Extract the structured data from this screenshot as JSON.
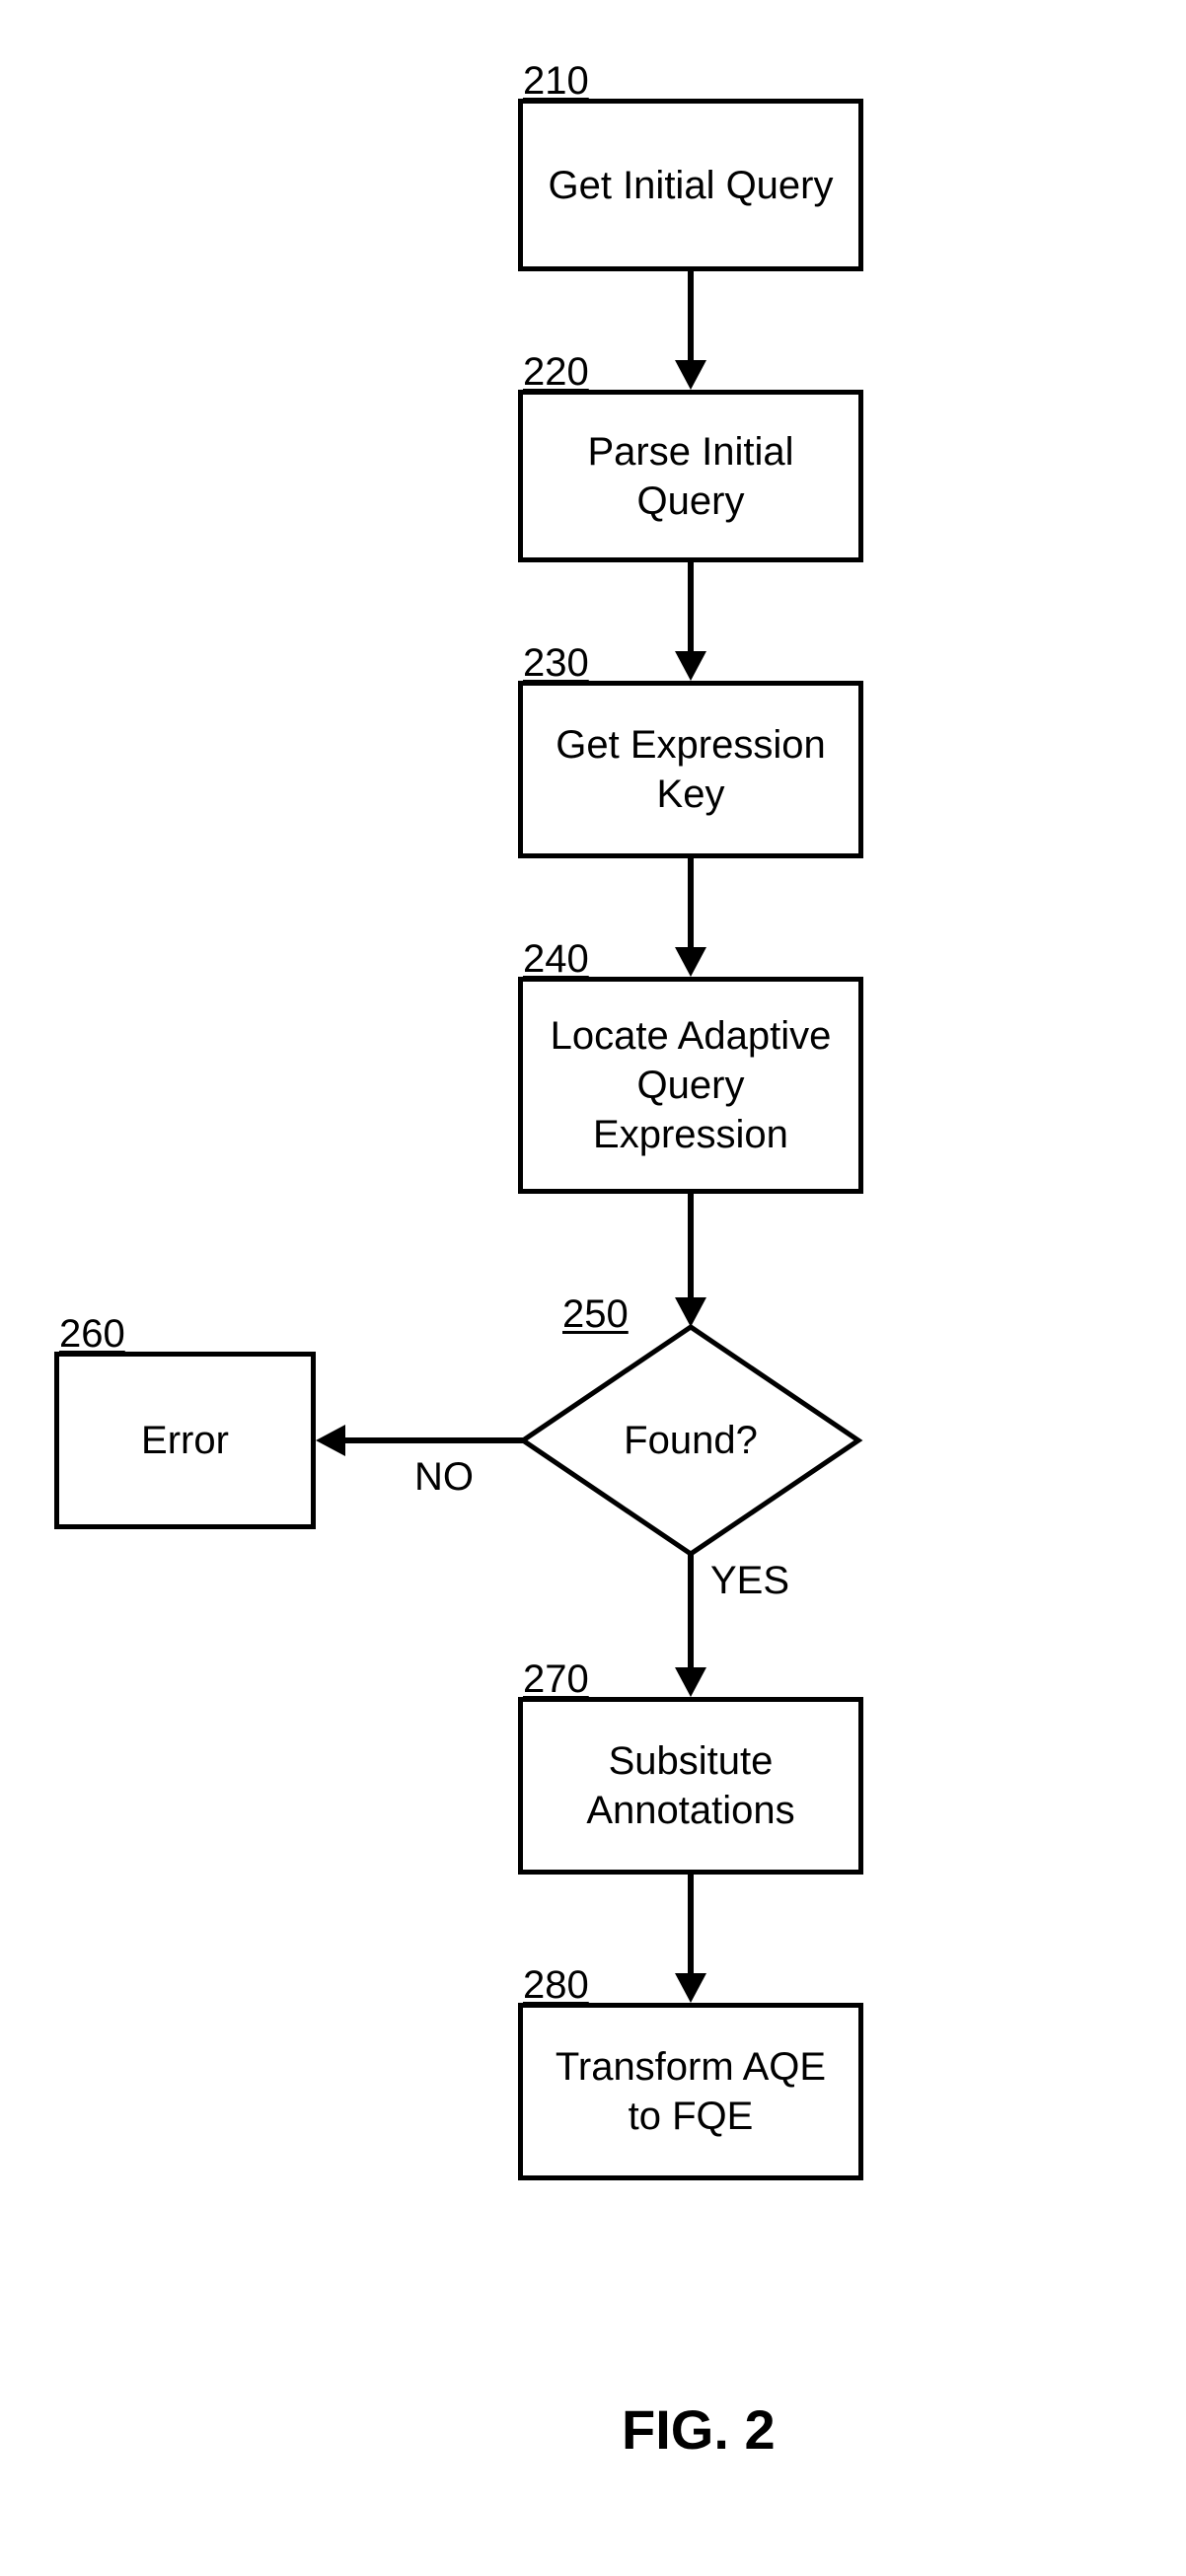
{
  "nodes": {
    "n210": {
      "num": "210",
      "label": "Get Initial Query"
    },
    "n220": {
      "num": "220",
      "label": "Parse Initial\nQuery"
    },
    "n230": {
      "num": "230",
      "label": "Get Expression\nKey"
    },
    "n240": {
      "num": "240",
      "label": "Locate Adaptive\nQuery\nExpression"
    },
    "n250": {
      "num": "250",
      "label": "Found?"
    },
    "n260": {
      "num": "260",
      "label": "Error"
    },
    "n270": {
      "num": "270",
      "label": "Subsitute\nAnnotations"
    },
    "n280": {
      "num": "280",
      "label": "Transform AQE\nto FQE"
    }
  },
  "edges": {
    "no": "NO",
    "yes": "YES"
  },
  "caption": "FIG. 2"
}
